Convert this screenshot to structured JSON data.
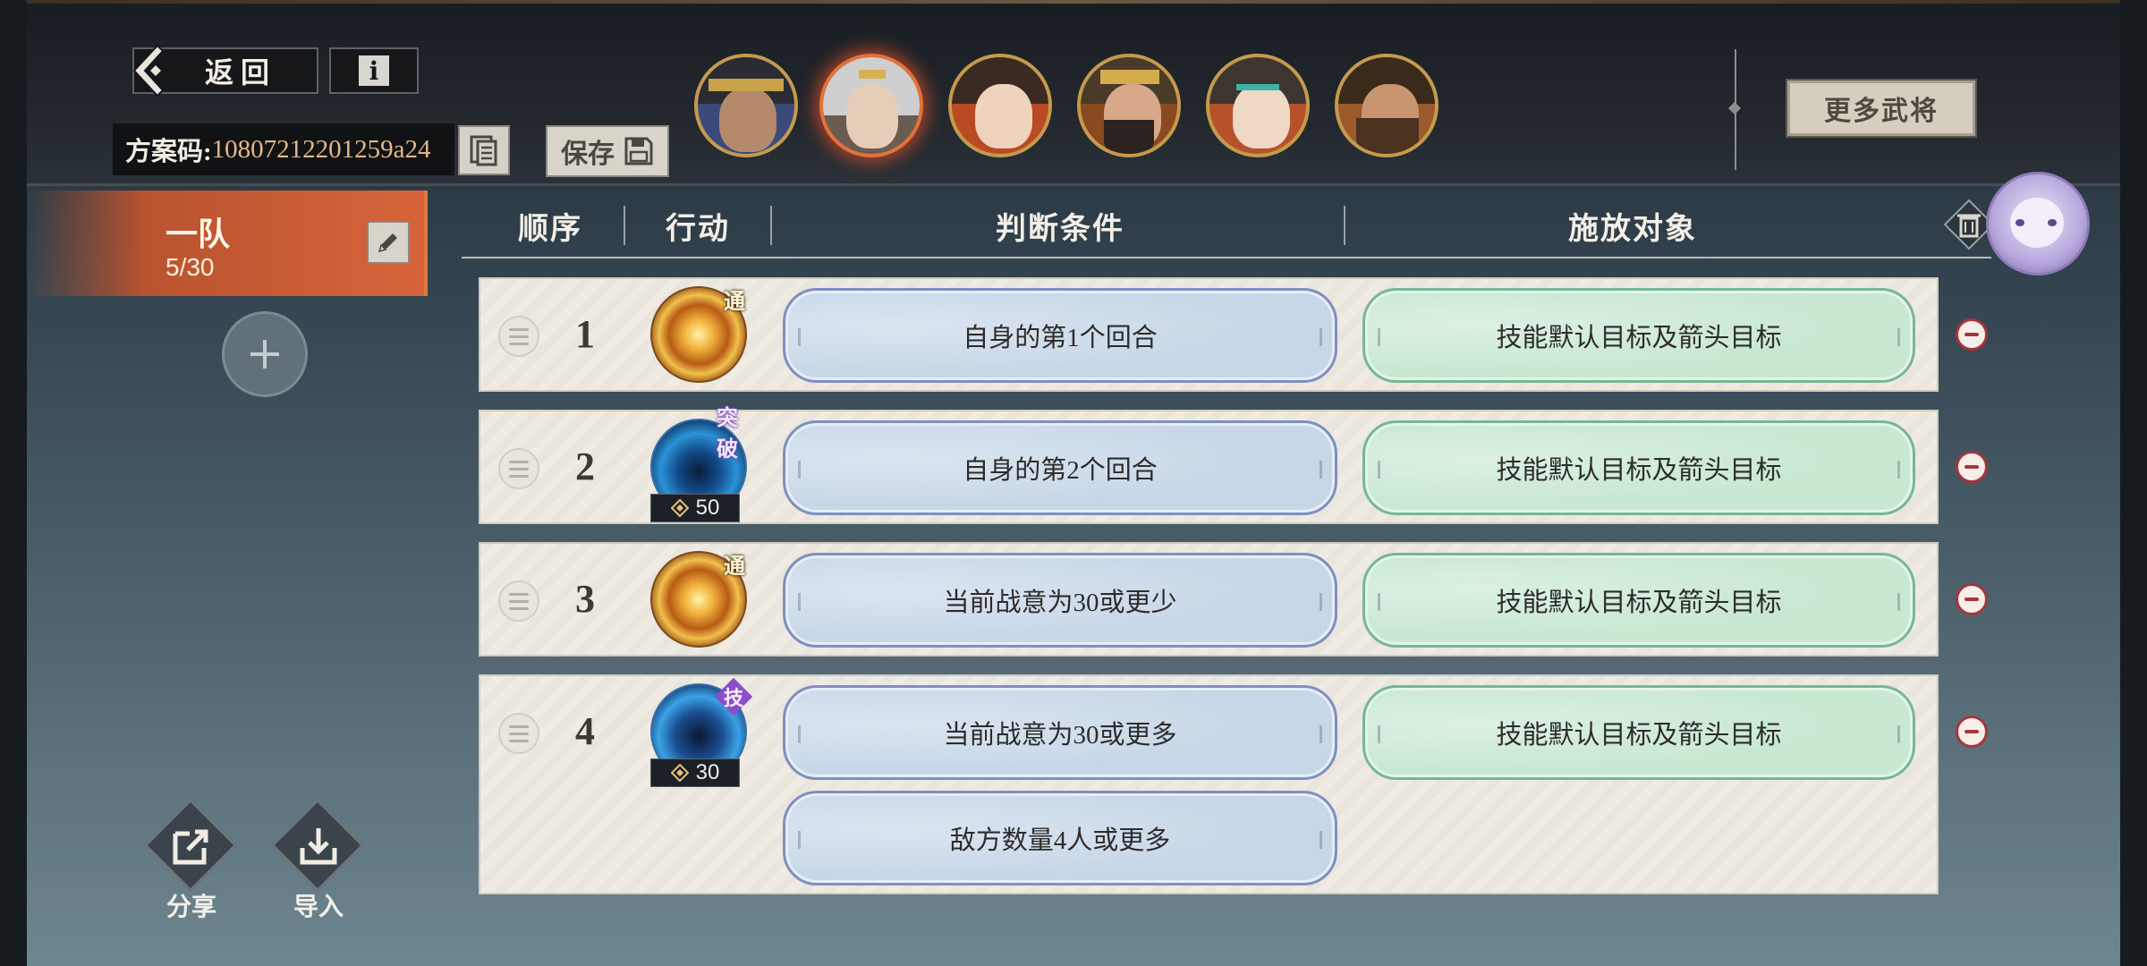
{
  "toolbar": {
    "back_label": "返回",
    "code_label": "方案码:",
    "code_value": "10807212201259a24",
    "save_label": "保存",
    "more_generals_label": "更多武将"
  },
  "team": {
    "name": "一队",
    "count": "5/30"
  },
  "bottom_tools": {
    "share_label": "分享",
    "import_label": "导入"
  },
  "table": {
    "headers": {
      "order": "顺序",
      "action": "行动",
      "condition": "判断条件",
      "target": "施放对象"
    },
    "rows": [
      {
        "order": "1",
        "skill": "gold-normal-attack",
        "badge": "通",
        "cost": "",
        "conditions": [
          "自身的第1个回合"
        ],
        "target": "技能默认目标及箭头目标"
      },
      {
        "order": "2",
        "skill": "blue-breakthrough-skill",
        "badge": "突破",
        "cost": "50",
        "conditions": [
          "自身的第2个回合"
        ],
        "target": "技能默认目标及箭头目标"
      },
      {
        "order": "3",
        "skill": "gold-normal-attack",
        "badge": "通",
        "cost": "",
        "conditions": [
          "当前战意为30或更少"
        ],
        "target": "技能默认目标及箭头目标"
      },
      {
        "order": "4",
        "skill": "blue-tactic-skill",
        "badge": "技",
        "cost": "30",
        "conditions": [
          "当前战意为30或更多",
          "敌方数量4人或更多"
        ],
        "target": "技能默认目标及箭头目标"
      }
    ]
  },
  "colors": {
    "accent": "#d6643a",
    "condition_pill": "#c8d7e8",
    "target_pill": "#c8e8d2",
    "remove": "#a8343c"
  }
}
